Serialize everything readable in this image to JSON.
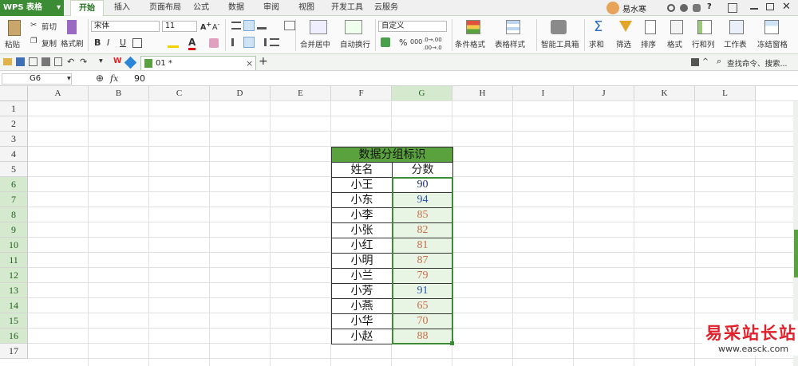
{
  "app": {
    "title": "WPS 表格",
    "caret": "▾"
  },
  "menu_tabs": [
    "开始",
    "插入",
    "页面布局",
    "公式",
    "数据",
    "审阅",
    "视图",
    "开发工具",
    "云服务"
  ],
  "account": {
    "user": "易水寒"
  },
  "window_controls": {
    "help": "?"
  },
  "ribbon": {
    "clipboard": {
      "paste": "粘贴",
      "cut": "剪切",
      "copy": "复制",
      "format_painter": "格式刷"
    },
    "font": {
      "name": "宋体",
      "size": "11",
      "bold": "B",
      "italic": "I",
      "underline": "U",
      "font_color": "A"
    },
    "alignment": {
      "merge_center": "合并居中",
      "wrap_text": "自动换行"
    },
    "number": {
      "format": "自定义",
      "percent": "%",
      "thousands": "000",
      "inc_decimal": ".0→.00",
      "dec_decimal": ".00→.0"
    },
    "styles": {
      "conditional": "条件格式",
      "table_style": "表格样式"
    },
    "smart": {
      "smart_toolbox": "智能工具箱"
    },
    "editing": {
      "sum": "求和",
      "filter": "筛选",
      "sort": "排序",
      "format": "格式",
      "rows_cols": "行和列",
      "worksheet": "工作表",
      "freeze": "冻结窗格"
    }
  },
  "doc_tab": {
    "name": "01 *",
    "close": "×",
    "new": "+"
  },
  "search": {
    "placeholder": "查找命令、搜索..."
  },
  "formula_bar": {
    "cell_ref": "G6",
    "fx": "fx",
    "value": "90"
  },
  "columns": [
    "A",
    "B",
    "C",
    "D",
    "E",
    "F",
    "G",
    "H",
    "I",
    "J",
    "K",
    "L"
  ],
  "rows": [
    "1",
    "2",
    "3",
    "4",
    "5",
    "6",
    "7",
    "8",
    "9",
    "10",
    "11",
    "12",
    "13",
    "14",
    "15",
    "16",
    "17"
  ],
  "table": {
    "title": "数据分组标识",
    "headers": [
      "姓名",
      "分数"
    ],
    "data": [
      {
        "name": "小王",
        "score": "90"
      },
      {
        "name": "小东",
        "score": "94"
      },
      {
        "name": "小李",
        "score": "85"
      },
      {
        "name": "小张",
        "score": "82"
      },
      {
        "name": "小红",
        "score": "81"
      },
      {
        "name": "小明",
        "score": "87"
      },
      {
        "name": "小兰",
        "score": "79"
      },
      {
        "name": "小芳",
        "score": "91"
      },
      {
        "name": "小燕",
        "score": "65"
      },
      {
        "name": "小华",
        "score": "70"
      },
      {
        "name": "小赵",
        "score": "88"
      }
    ]
  },
  "colors": {
    "accent": "#3c8c35",
    "title_fill": "#5aa23d",
    "selection": "#e8f4e4",
    "score_high": "#2d56a8",
    "score_low": "#c9704a"
  },
  "watermark": {
    "brand": "易采站长站",
    "url": "www.easck.com"
  }
}
